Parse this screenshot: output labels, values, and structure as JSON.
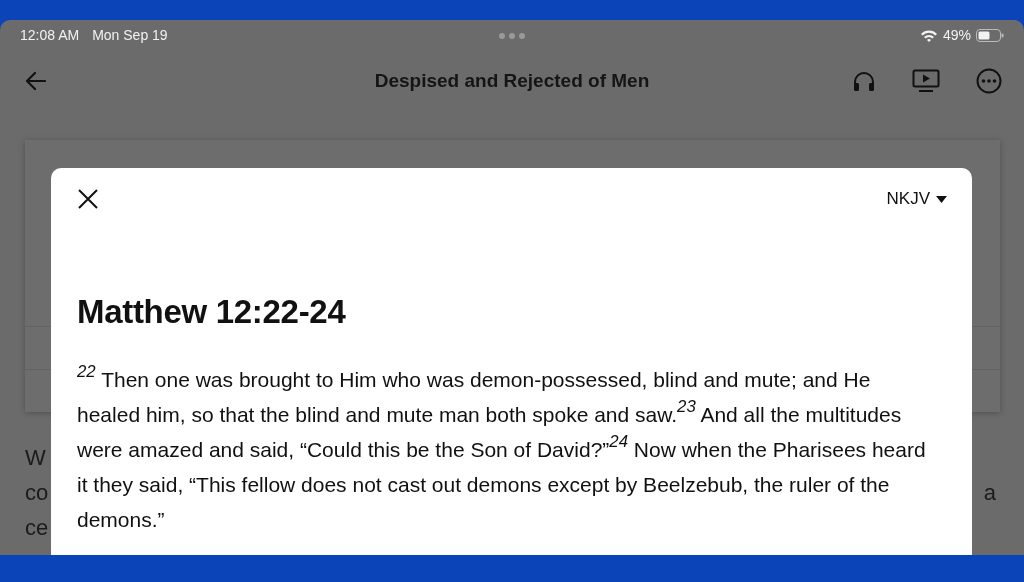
{
  "status_bar": {
    "time": "12:08 AM",
    "date": "Mon Sep 19",
    "battery": "49%"
  },
  "header": {
    "title": "Despised and Rejected of Men"
  },
  "background_text": {
    "left": [
      "W",
      "co",
      "ce"
    ],
    "right": [
      "a"
    ]
  },
  "modal": {
    "version": "NKJV",
    "title": "Matthew 12:22-24",
    "passage": "$^{22}$ Then one was brought to Him who was demon-possessed, blind and mute; and He healed him, so that the blind and mute man both spoke and saw.$^{23}$ And all the multitudes were amazed and said, “Could this be the Son of David?”$^{24}$ Now when the Pharisees heard it they said, “This fellow does not cast out demons except by Beelzebub, the ruler of the demons.”"
  }
}
